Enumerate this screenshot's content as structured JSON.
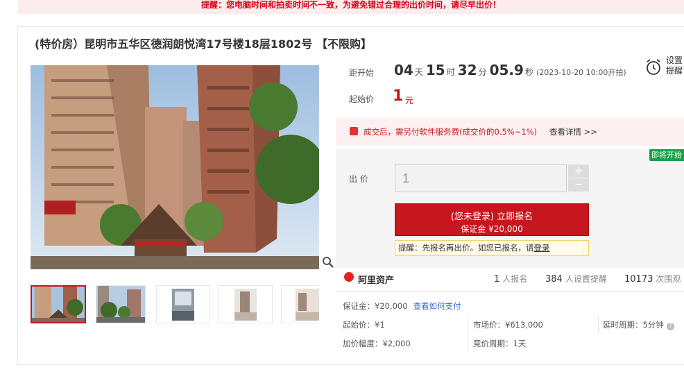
{
  "notice": "提醒：您电脑时间和拍卖时间不一致，为避免错过合理的出价时间，请尽早出价！",
  "title": "(特价房）昆明市五华区德润朗悦湾17号楼18层1802号 【不限购】",
  "countdown": {
    "label": "距开始",
    "days": "04",
    "days_unit": "天",
    "hours": "15",
    "hours_unit": "时",
    "minutes": "32",
    "minutes_unit": "分",
    "seconds": "05.9",
    "seconds_unit": "秒",
    "start_time": "(2023-10-20 10:00开拍)"
  },
  "remind": {
    "line1": "设置",
    "line2": "提醒"
  },
  "start_price": {
    "label": "起始价",
    "value": "1",
    "unit": "元"
  },
  "fee_notice": {
    "text": "成交后，需另付软件服务费(成交价的0.5%~1%)",
    "link": "查看详情 >>"
  },
  "soon_tag": "即将开始",
  "bid": {
    "label": "出 价",
    "value": "1",
    "plus": "+",
    "minus": "−"
  },
  "signup": {
    "line1": "(您未登录) 立即报名",
    "line2": "保证金 ¥20,000"
  },
  "tip": {
    "text": "提醒：先报名再出价。如您已报名，请",
    "link": "登录"
  },
  "platform": "阿里资产",
  "stats": [
    {
      "value": "1",
      "unit": "人报名"
    },
    {
      "value": "384",
      "unit": "人设置提醒"
    },
    {
      "value": "10173",
      "unit": "次围观"
    }
  ],
  "deposit": {
    "text": "保证金：¥20,000",
    "link": "查看如何支付"
  },
  "details": {
    "start_price": "起始价：¥1",
    "market_price": "市场价：¥613,000",
    "delay": "延时周期：5分钟",
    "increment": "加价幅度：¥2,000",
    "bid_cycle": "竞价周期：1天"
  },
  "colors": {
    "accent": "#c6161e",
    "green_tag": "#19a24b",
    "link": "#3366cc"
  }
}
